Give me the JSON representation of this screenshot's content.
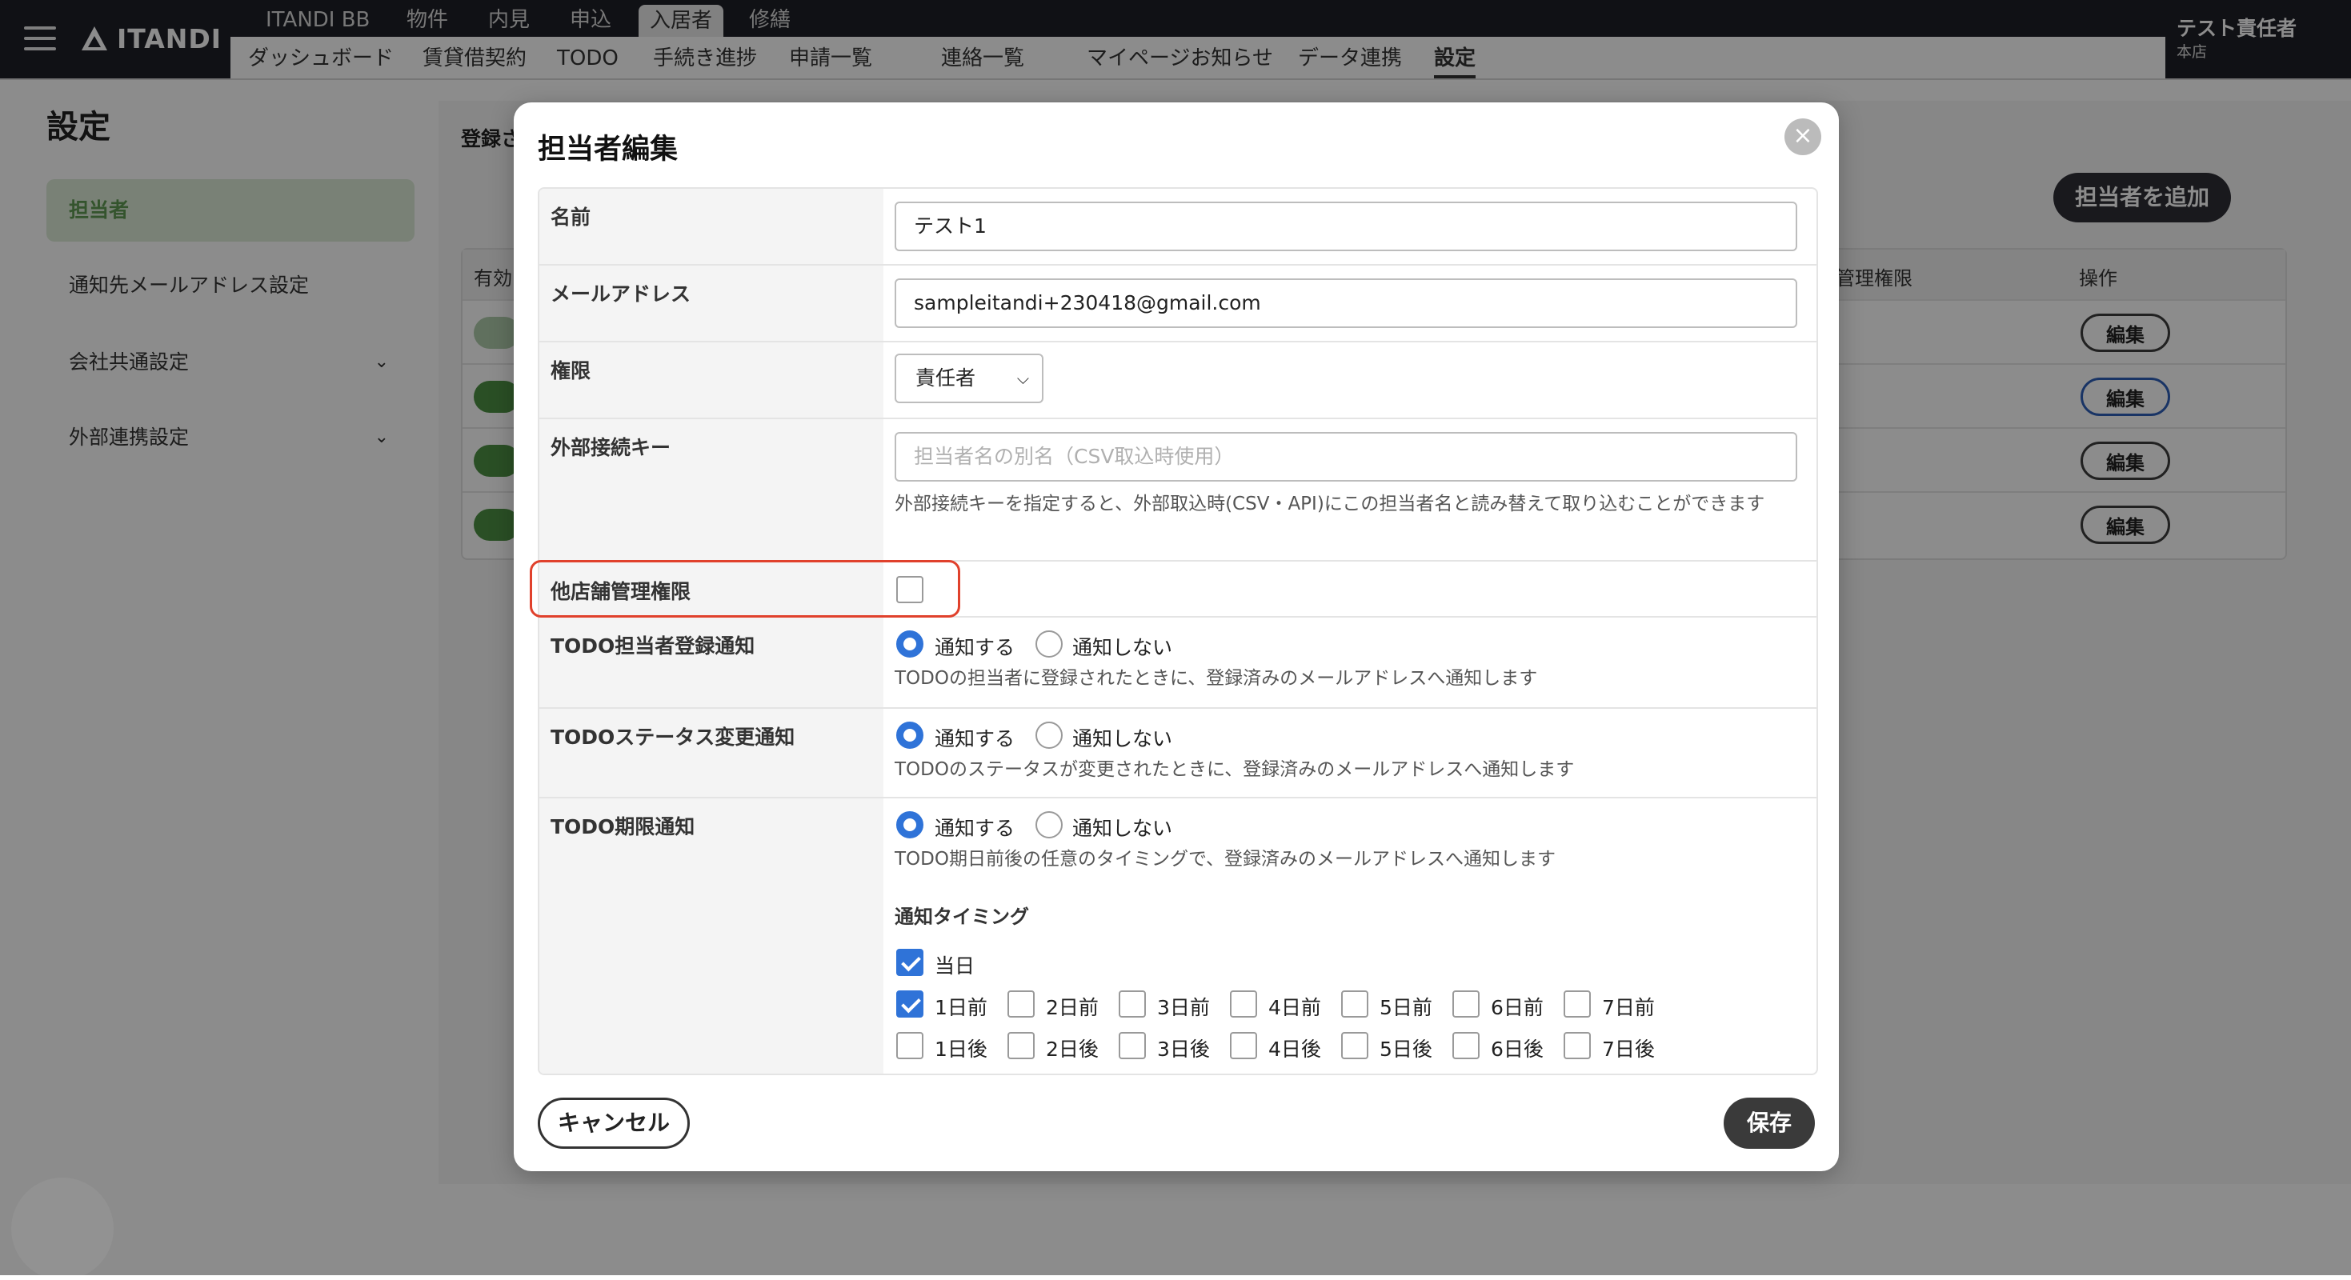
{
  "app": {
    "logo_text": "ITANDI",
    "product_tabs": [
      "ITANDI BB",
      "物件",
      "内見",
      "申込",
      "入居者",
      "修繕"
    ],
    "sub_tabs": [
      "ダッシュボード",
      "賃貸借契約",
      "TODO",
      "手続き進捗",
      "申請一覧",
      "連絡一覧",
      "マイページお知らせ",
      "データ連携",
      "設定"
    ],
    "user_name": "テスト責任者",
    "user_store": "本店"
  },
  "page": {
    "title": "設定",
    "sidebar": [
      {
        "label": "担当者"
      },
      {
        "label": "通知先メールアドレス設定"
      },
      {
        "label": "会社共通設定"
      },
      {
        "label": "外部連携設定"
      }
    ],
    "main_title": "登録さ",
    "add_button": "担当者を追加",
    "table_headers": {
      "enabled": "有効",
      "mgmt": "管理権限",
      "ops": "操作"
    },
    "edit_label": "編集"
  },
  "modal": {
    "title": "担当者編集",
    "close_icon": "×",
    "fields": {
      "name_label": "名前",
      "name_value": "テスト1",
      "email_label": "メールアドレス",
      "email_value": "sampleitandi+230418@gmail.com",
      "role_label": "権限",
      "role_value": "責任者",
      "extkey_label": "外部接続キー",
      "extkey_placeholder": "担当者名の別名（CSV取込時使用）",
      "extkey_help": "外部接続キーを指定すると、外部取込時(CSV・API)にこの担当者名と読み替えて取り込むことができます",
      "other_store_label": "他店舗管理権限",
      "other_store_checked": false,
      "todo_assign_label": "TODO担当者登録通知",
      "todo_assign_help": "TODOの担当者に登録されたときに、登録済みのメールアドレスへ通知します",
      "todo_status_label": "TODOステータス変更通知",
      "todo_status_help": "TODOのステータスが変更されたときに、登録済みのメールアドレスへ通知します",
      "todo_deadline_label": "TODO期限通知",
      "todo_deadline_help": "TODO期日前後の任意のタイミングで、登録済みのメールアドレスへ通知します",
      "notify_on": "通知する",
      "notify_off": "通知しない",
      "timing_label": "通知タイミング",
      "timing_today": "当日",
      "timing_before": [
        "1日前",
        "2日前",
        "3日前",
        "4日前",
        "5日前",
        "6日前",
        "7日前"
      ],
      "timing_after": [
        "1日後",
        "2日後",
        "3日後",
        "4日後",
        "5日後",
        "6日後",
        "7日後"
      ]
    },
    "cancel": "キャンセル",
    "save": "保存"
  }
}
